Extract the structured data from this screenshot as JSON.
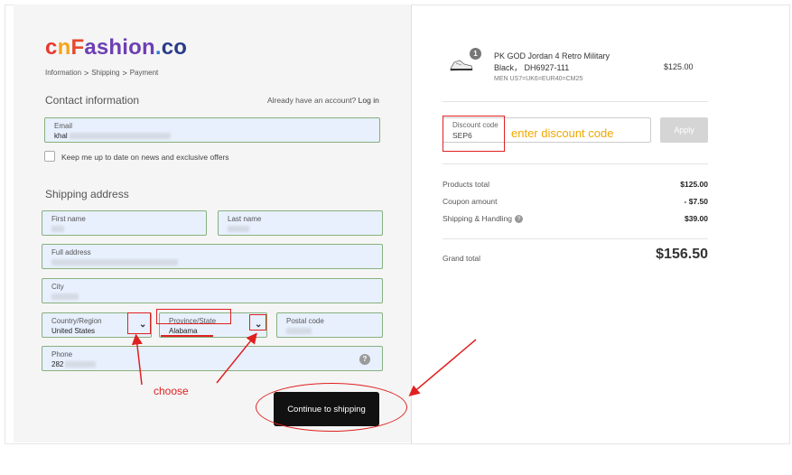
{
  "brand": {
    "logo_parts": [
      "c",
      "n",
      "F",
      "ashion",
      ".",
      "co"
    ]
  },
  "breadcrumb": {
    "items": [
      "Information",
      "Shipping",
      "Payment"
    ],
    "separator": ">"
  },
  "contact": {
    "heading": "Contact information",
    "login_prompt": "Already have an account?",
    "login_link": "Log in",
    "email_label": "Email",
    "email_value": "khal",
    "newsletter_label": "Keep me up to date on news and exclusive offers"
  },
  "shipping": {
    "heading": "Shipping address",
    "first_name_label": "First name",
    "last_name_label": "Last name",
    "address_label": "Full address",
    "city_label": "City",
    "country_label": "Country/Region",
    "country_value": "United States",
    "province_label": "Province/State",
    "province_value": "Alabama",
    "postal_label": "Postal code",
    "phone_label": "Phone",
    "phone_value": "282",
    "continue_button": "Continue to shipping"
  },
  "annotations": {
    "choose": "choose",
    "discount_hint": "enter discount code",
    "color": "#e02020",
    "hint_color": "#f0a800"
  },
  "cart": {
    "item": {
      "quantity": "1",
      "name": "PK GOD Jordan 4 Retro Military Black， DH6927-111",
      "variant": "MEN US7=UK6=EUR40=CM25",
      "price": "$125.00"
    },
    "discount": {
      "label": "Discount code",
      "value": "SEP6",
      "apply_button": "Apply"
    },
    "summary": {
      "products_total_label": "Products total",
      "products_total": "$125.00",
      "coupon_label": "Coupon amount",
      "coupon": "- $7.50",
      "shipping_label": "Shipping & Handling",
      "shipping": "$39.00",
      "grand_total_label": "Grand total",
      "grand_total": "$156.50"
    }
  }
}
